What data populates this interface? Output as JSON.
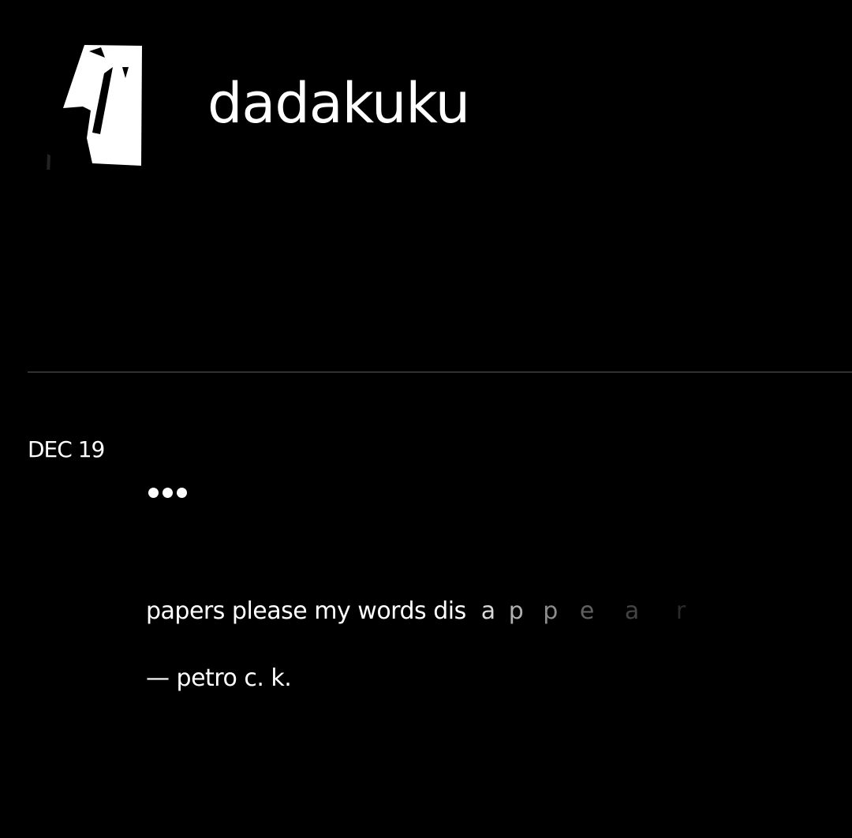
{
  "header": {
    "site_title": "dadakuku",
    "logo_icon": "mask-face-logo-icon"
  },
  "post": {
    "date": "DEC 19",
    "menu_icon": "ellipsis-icon",
    "poem_main": "papers please my words dis",
    "poem_fading_letters": [
      "a",
      "p",
      "p",
      "e",
      "a",
      "r"
    ],
    "attribution": "— petro c. k."
  },
  "colors": {
    "background": "#000000",
    "text": "#ffffff",
    "divider": "#5a5a5a"
  }
}
